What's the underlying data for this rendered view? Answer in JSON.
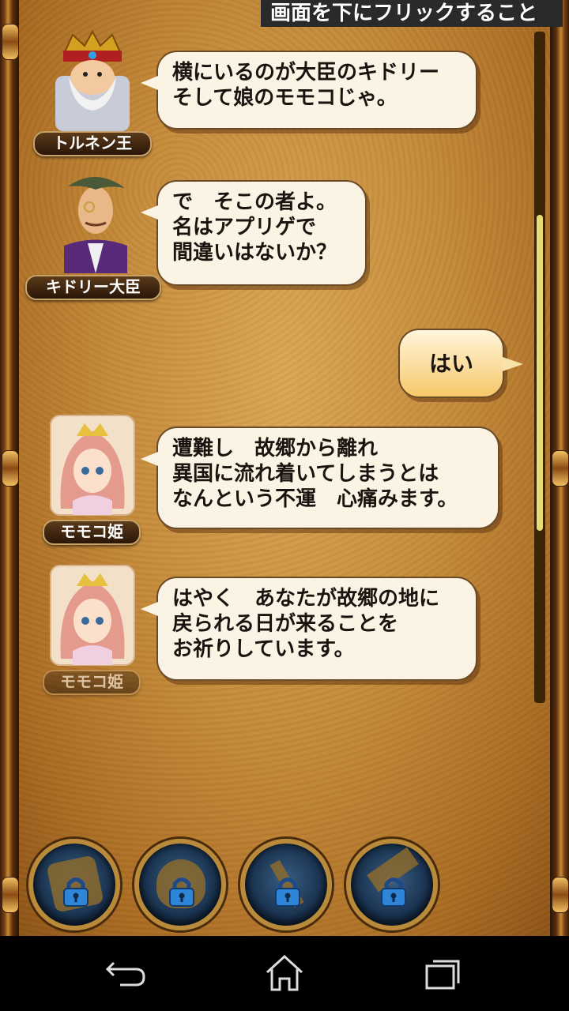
{
  "header": {
    "text": "画面を下にフリックすること"
  },
  "dialogue": [
    {
      "speaker": "トルネン王",
      "text_line1": "横にいるのが大臣のキドリー",
      "text_line2": "そして娘のモモコじゃ。",
      "text_line3": ""
    },
    {
      "speaker": "キドリー大臣",
      "text_line1": "で　そこの者よ。",
      "text_line2": "名はアプリゲで",
      "text_line3": "間違いはないか？"
    },
    {
      "speaker": "",
      "text_line1": "はい"
    },
    {
      "speaker": "モモコ姫",
      "text_line1": "遭難し　故郷から離れ",
      "text_line2": "異国に流れ着いてしまうとは",
      "text_line3": "なんという不運　心痛みます。"
    },
    {
      "speaker": "モモコ姫",
      "text_line1": "はやく　あなたが故郷の地に",
      "text_line2": "戻られる日が来ることを",
      "text_line3": "お祈りしています。"
    }
  ],
  "menu_buttons": [
    {
      "icon": "bag-icon",
      "locked": true
    },
    {
      "icon": "character-icon",
      "locked": true
    },
    {
      "icon": "weapon-icon",
      "locked": true
    },
    {
      "icon": "hammer-icon",
      "locked": true
    }
  ],
  "navbar": {
    "icons": [
      "back-icon",
      "home-icon",
      "recent-apps-icon"
    ]
  },
  "colors": {
    "accent_gold": "#b98a3a",
    "bubble": "#fbf3e3",
    "player_bubble": "#f7c86a"
  }
}
